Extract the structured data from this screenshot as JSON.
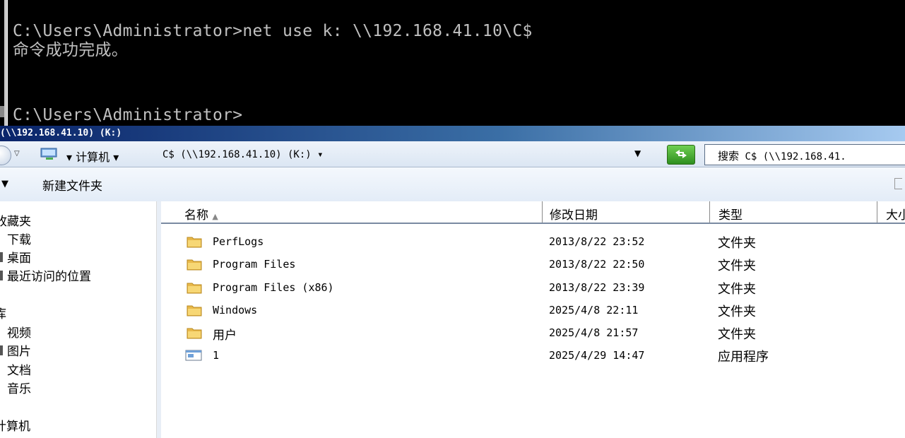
{
  "console": {
    "line1": "C:\\Users\\Administrator>net use k: \\\\192.168.41.10\\C$",
    "line2": "命令成功完成。",
    "line3": "C:\\Users\\Administrator>"
  },
  "window": {
    "title": "(\\\\192.168.41.10) (K:)"
  },
  "address": {
    "seg_computer": "▾ 计算机 ▾",
    "seg_drive": "C$ (\\\\192.168.41.10) (K:) ▾",
    "dropdown_glyph": "▼",
    "search_label": "搜索",
    "search_rest": " C$ (\\\\192.168.41."
  },
  "toolbar": {
    "organize_arrow": "▼",
    "new_folder": "新建文件夹"
  },
  "sidebar": {
    "favorites": "收藏夹",
    "downloads": "下载",
    "desktop": "桌面",
    "recent": "最近访问的位置",
    "libraries": "库",
    "videos": "视频",
    "pictures": "图片",
    "documents": "文档",
    "music": "音乐",
    "computer": "计算机"
  },
  "columns": {
    "name": "名称",
    "modified": "修改日期",
    "type": "类型",
    "size": "大小"
  },
  "files": [
    {
      "name": "PerfLogs",
      "modified": "2013/8/22 23:52",
      "type": "文件夹",
      "icon": "folder-icon"
    },
    {
      "name": "Program Files",
      "modified": "2013/8/22 22:50",
      "type": "文件夹",
      "icon": "folder-icon"
    },
    {
      "name": "Program Files (x86)",
      "modified": "2013/8/22 23:39",
      "type": "文件夹",
      "icon": "folder-icon"
    },
    {
      "name": "Windows",
      "modified": "2025/4/8 22:11",
      "type": "文件夹",
      "icon": "folder-icon"
    },
    {
      "name": "用户",
      "modified": "2025/4/8 21:57",
      "type": "文件夹",
      "icon": "folder-icon"
    },
    {
      "name": "1",
      "modified": "2025/4/29 14:47",
      "type": "应用程序",
      "icon": "application-icon"
    }
  ]
}
